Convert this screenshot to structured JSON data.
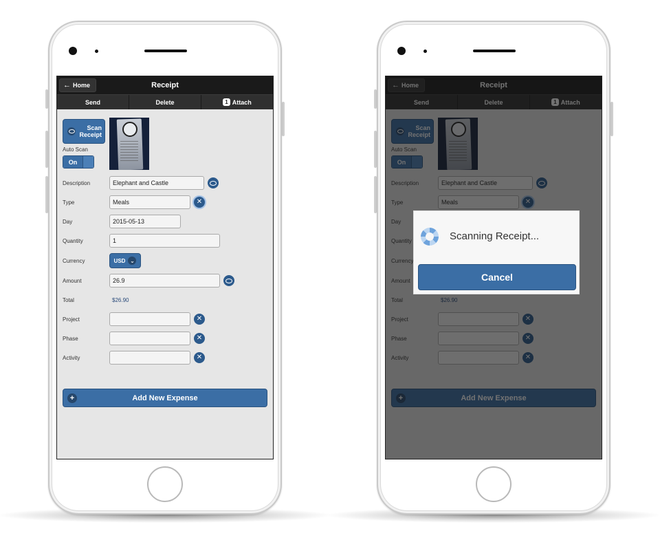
{
  "header": {
    "home_label": "Home",
    "title": "Receipt"
  },
  "navbar": {
    "send": "Send",
    "delete": "Delete",
    "attach": "Attach",
    "attach_count": "1"
  },
  "form": {
    "scan_button": "Scan Receipt",
    "auto_scan_label": "Auto Scan",
    "auto_scan_state": "On",
    "description_label": "Description",
    "description_value": "Elephant and Castle",
    "type_label": "Type",
    "type_value": "Meals",
    "day_label": "Day",
    "day_value": "2015-05-13",
    "quantity_label": "Quantity",
    "quantity_value": "1",
    "currency_label": "Currency",
    "currency_value": "USD",
    "amount_label": "Amount",
    "amount_value": "26.9",
    "total_label": "Total",
    "total_value": "$26.90",
    "project_label": "Project",
    "project_value": "",
    "phase_label": "Phase",
    "phase_value": "",
    "activity_label": "Activity",
    "activity_value": "",
    "add_button": "Add New Expense"
  },
  "dialog": {
    "message": "Scanning Receipt...",
    "cancel": "Cancel"
  },
  "icons": {
    "back": "arrow-left-icon",
    "eye": "eye-icon",
    "clear": "close-circle-icon",
    "chevron": "chevron-down-icon",
    "add": "plus-icon",
    "spinner": "spinner-icon"
  },
  "colors": {
    "accent": "#3b6ea5",
    "header_bg": "#1a1a1a",
    "navbar_bg": "#2f2f2f",
    "screen_bg": "#e6e6e6"
  }
}
